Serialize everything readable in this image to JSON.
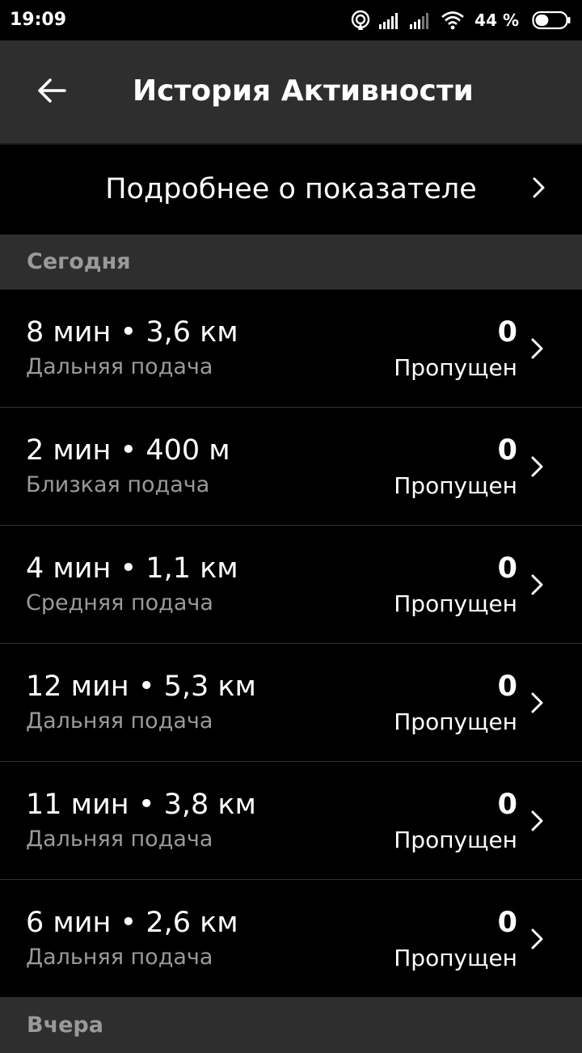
{
  "status_bar": {
    "time": "19:09",
    "battery_percent": "44 %",
    "battery_level": 0.44,
    "icons": [
      "hotspot-icon",
      "signal-icon",
      "signal-icon",
      "wifi-icon",
      "battery-icon"
    ]
  },
  "header": {
    "title": "История Активности",
    "back_icon": "arrow-left-icon"
  },
  "info": {
    "label": "Подробнее о показателе"
  },
  "sections": [
    {
      "label": "Сегодня",
      "orders": [
        {
          "title": "8 мин • 3,6 км",
          "type": "Дальняя подача",
          "value": "0",
          "status": "Пропущен"
        },
        {
          "title": "2 мин • 400 м",
          "type": "Близкая подача",
          "value": "0",
          "status": "Пропущен"
        },
        {
          "title": "4 мин • 1,1 км",
          "type": "Средняя подача",
          "value": "0",
          "status": "Пропущен"
        },
        {
          "title": "12 мин • 5,3 км",
          "type": "Дальняя подача",
          "value": "0",
          "status": "Пропущен"
        },
        {
          "title": "11 мин • 3,8 км",
          "type": "Дальняя подача",
          "value": "0",
          "status": "Пропущен"
        },
        {
          "title": "6 мин • 2,6 км",
          "type": "Дальняя подача",
          "value": "0",
          "status": "Пропущен"
        }
      ]
    },
    {
      "label": "Вчера",
      "orders": []
    }
  ],
  "colors": {
    "background": "#000000",
    "header_bg": "#2e2e2e",
    "secondary_text": "#9a9a9a",
    "primary_text": "#ffffff"
  }
}
